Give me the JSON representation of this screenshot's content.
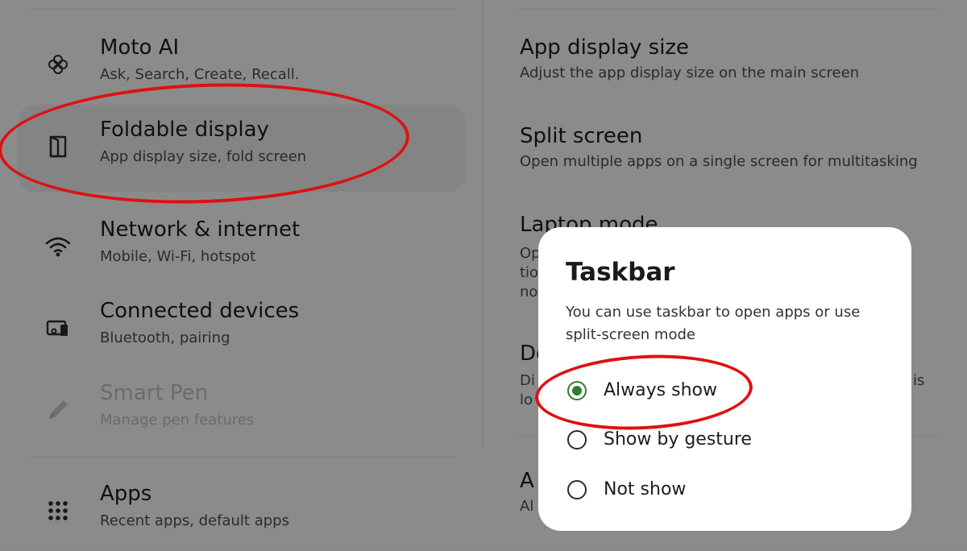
{
  "settings_list": [
    {
      "title": "Moto AI",
      "subtitle": "Ask, Search, Create, Recall.",
      "icon": "flower-icon",
      "state": "normal"
    },
    {
      "title": "Foldable display",
      "subtitle": "App display size, fold screen",
      "icon": "book-icon",
      "state": "selected"
    },
    {
      "title": "Network & internet",
      "subtitle": "Mobile, Wi-Fi, hotspot",
      "icon": "wifi-icon",
      "state": "normal"
    },
    {
      "title": "Connected devices",
      "subtitle": "Bluetooth, pairing",
      "icon": "devices-icon",
      "state": "normal"
    },
    {
      "title": "Smart Pen",
      "subtitle": "Manage pen features",
      "icon": "pen-icon",
      "state": "disabled"
    },
    {
      "title": "Apps",
      "subtitle": "Recent apps, default apps",
      "icon": "grid-icon",
      "state": "normal"
    }
  ],
  "detail_list": [
    {
      "title": "App display size",
      "subtitle": "Adjust the app display size on the main screen"
    },
    {
      "title": "Split screen",
      "subtitle": "Open multiple apps on a single screen for multitasking"
    },
    {
      "title": "Laptop mode"
    }
  ],
  "obscured_fragments": [
    "Op",
    "tio",
    "no",
    "De",
    "Di",
    "lo",
    "is",
    "A",
    "Al"
  ],
  "dialog": {
    "title": "Taskbar",
    "description": "You can use taskbar to open apps or use split-screen mode",
    "options": [
      {
        "label": "Always show",
        "selected": true
      },
      {
        "label": "Show by gesture",
        "selected": false
      },
      {
        "label": "Not show",
        "selected": false
      }
    ]
  },
  "colors": {
    "annotation": "#e01010",
    "radio_selected": "#2e7d32"
  }
}
